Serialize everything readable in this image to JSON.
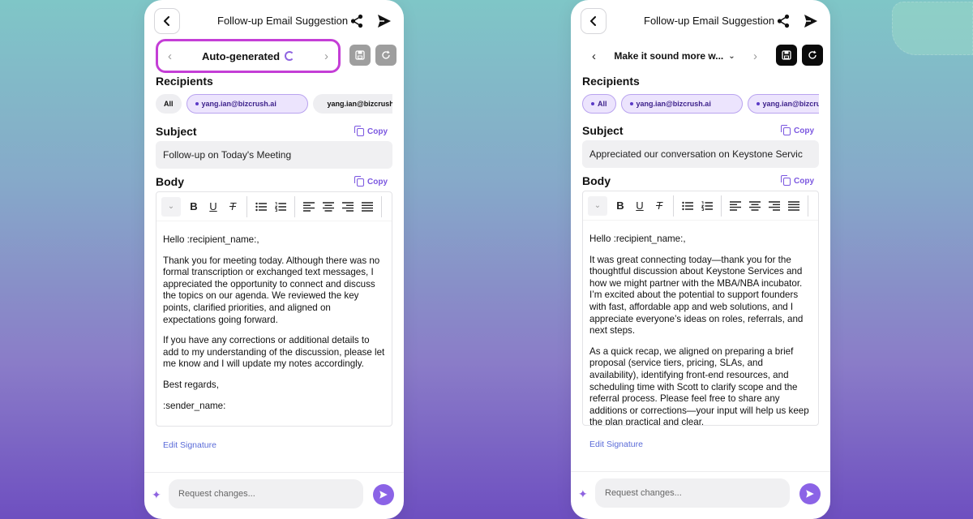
{
  "left": {
    "header": {
      "title": "Follow-up Email Suggestion"
    },
    "selector": {
      "label": "Auto-generated"
    },
    "recipients": {
      "title": "Recipients",
      "chips": [
        "All",
        "yang.ian@bizcrush.ai",
        "yang.ian@bizcrush"
      ]
    },
    "subject": {
      "title": "Subject",
      "copy": "Copy",
      "value": "Follow-up on Today's Meeting"
    },
    "body": {
      "title": "Body",
      "copy": "Copy",
      "paragraphs": [
        "Hello :recipient_name:,",
        "Thank you for meeting today. Although there was no formal transcription or exchanged text messages, I appreciated the opportunity to connect and discuss the topics on our agenda. We reviewed the key points, clarified priorities, and aligned on expectations going forward.",
        "If you have any corrections or additional details to add to my understanding of the discussion, please let me know and I will update my notes accordingly.",
        "Best regards,",
        ":sender_name:"
      ]
    },
    "edit_signature": "Edit Signature",
    "request": {
      "placeholder": "Request changes..."
    }
  },
  "right": {
    "header": {
      "title": "Follow-up Email Suggestion"
    },
    "selector": {
      "label": "Make it sound more w..."
    },
    "recipients": {
      "title": "Recipients",
      "chips": [
        "All",
        "yang.ian@bizcrush.ai",
        "yang.ian@bizcru"
      ]
    },
    "subject": {
      "title": "Subject",
      "copy": "Copy",
      "value": "Appreciated our conversation on Keystone Servic"
    },
    "body": {
      "title": "Body",
      "copy": "Copy",
      "paragraphs": [
        "Hello :recipient_name:,",
        "It was great connecting today—thank you for the thoughtful discussion about Keystone Services and how we might partner with the MBA/NBA incubator. I’m excited about the potential to support founders with fast, affordable app and web solutions, and I appreciate everyone’s ideas on roles, referrals, and next steps.",
        "As a quick recap, we aligned on preparing a brief proposal (service tiers, pricing, SLAs, and availability), identifying front-end resources, and scheduling time with Scott to clarify scope and the referral process. Please feel free to share any additions or corrections—your input will help us keep the plan practical and clear."
      ]
    },
    "edit_signature": "Edit Signature",
    "request": {
      "placeholder": "Request changes..."
    }
  },
  "colors": {
    "accent": "#8b63e6",
    "highlight": "#c43ed6",
    "link": "#5a6bd8"
  },
  "icons": [
    "chevron-left-icon",
    "share-icon",
    "send-icon",
    "save-icon",
    "refresh-icon",
    "spinner-icon",
    "copy-icon",
    "bold-icon",
    "underline-icon",
    "clear-format-icon",
    "bullet-list-icon",
    "numbered-list-icon",
    "align-left-icon",
    "align-center-icon",
    "align-right-icon",
    "justify-icon",
    "sparkle-icon"
  ]
}
